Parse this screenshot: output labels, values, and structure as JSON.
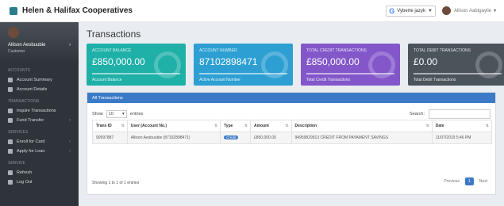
{
  "app": {
    "title": "Helen & Halifax Cooperatives"
  },
  "topbar": {
    "lang_label": "Vyberte jazyk",
    "user_name": "Allison Aabtgaylie"
  },
  "sidebar": {
    "profile_name": "Allison Aesbuubie",
    "profile_role": "Customer",
    "sections": [
      {
        "title": "ACCOUNTS",
        "items": [
          "Account Summary",
          "Account Details"
        ]
      },
      {
        "title": "TRANSACTIONS",
        "items": [
          "Inquire Transactions",
          "Fund Transfer"
        ]
      },
      {
        "title": "SERVICES",
        "items": [
          "Enroll for Card",
          "Apply for Loan"
        ]
      },
      {
        "title": "SERVICE",
        "items": [
          "Refresh",
          "Log Out"
        ]
      }
    ]
  },
  "page": {
    "title": "Transactions"
  },
  "cards": [
    {
      "label": "ACCOUNT BALANCE",
      "value": "£850,000.00",
      "footer": "Account Balance",
      "color": "#1fb0a8"
    },
    {
      "label": "ACCOUNT NUMBER",
      "value": "87102898471",
      "footer": "Active Account Number",
      "color": "#2d9fd3"
    },
    {
      "label": "TOTAL CREDIT TRANSACTIONS",
      "value": "£850,000.00",
      "footer": "Total Credit Transactions",
      "color": "#8357c9"
    },
    {
      "label": "TOTAL DEBIT TRANSACTIONS",
      "value": "£0.00",
      "footer": "Total Debit Transactions",
      "color": "#4b535b"
    }
  ],
  "panel": {
    "title": "All Transactions",
    "show_label": "Show",
    "entries_value": "10",
    "entries_label": "entries",
    "search_label": "Search:",
    "table": {
      "headers": [
        "Trans ID",
        "User (Account No.)",
        "Type",
        "Amount",
        "Description",
        "Date"
      ],
      "rows": [
        {
          "id": "90997887",
          "user": "Allison Aesbuubie (87102898471)",
          "type": "Credit",
          "amount": "£850,000.00",
          "desc": "94959829913 CREDIT FROM PAYAMENT SAVINGS",
          "date": "11/07/2019 5:46 PM"
        }
      ]
    },
    "footer": "Showing 1 to 1 of 1 entries",
    "pager": {
      "prev": "Previous",
      "current": "1",
      "next": "Next"
    }
  }
}
